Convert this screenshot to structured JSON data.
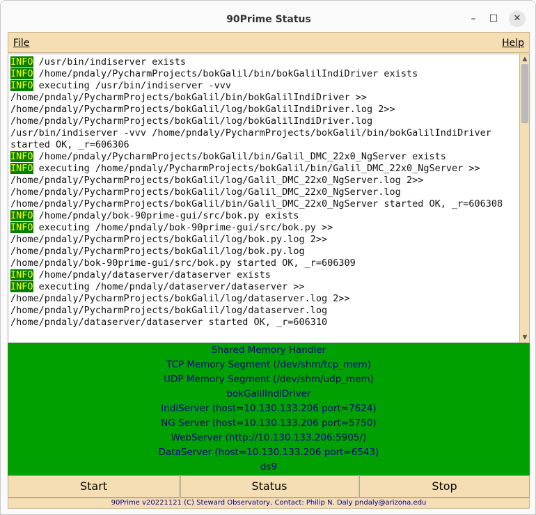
{
  "window": {
    "title": "90Prime Status",
    "controls": {
      "minimize": "–",
      "maximize": "☐",
      "close": "✕"
    }
  },
  "menubar": {
    "file_label": "File",
    "help_label": "Help"
  },
  "log": {
    "lines": [
      {
        "tag": "INFO",
        "text": " /usr/bin/indiserver exists"
      },
      {
        "tag": "INFO",
        "text": " /home/pndaly/PycharmProjects/bokGalil/bin/bokGalilIndiDriver exists"
      },
      {
        "tag": "INFO",
        "text": " executing /usr/bin/indiserver -vvv"
      },
      {
        "tag": "",
        "text": "/home/pndaly/PycharmProjects/bokGalil/bin/bokGalilIndiDriver >>"
      },
      {
        "tag": "",
        "text": "/home/pndaly/PycharmProjects/bokGalil/log/bokGalilIndiDriver.log 2>>"
      },
      {
        "tag": "",
        "text": "/home/pndaly/PycharmProjects/bokGalil/log/bokGalilIndiDriver.log"
      },
      {
        "tag": "",
        "text": "/usr/bin/indiserver -vvv /home/pndaly/PycharmProjects/bokGalil/bin/bokGalilIndiDriver"
      },
      {
        "tag": "",
        "text": "started OK, _r=606306"
      },
      {
        "tag": "INFO",
        "text": " /home/pndaly/PycharmProjects/bokGalil/bin/Galil_DMC_22x0_NgServer exists"
      },
      {
        "tag": "INFO",
        "text": " executing /home/pndaly/PycharmProjects/bokGalil/bin/Galil_DMC_22x0_NgServer >>"
      },
      {
        "tag": "",
        "text": "/home/pndaly/PycharmProjects/bokGalil/log/Galil_DMC_22x0_NgServer.log 2>>"
      },
      {
        "tag": "",
        "text": "/home/pndaly/PycharmProjects/bokGalil/log/Galil_DMC_22x0_NgServer.log"
      },
      {
        "tag": "",
        "text": "/home/pndaly/PycharmProjects/bokGalil/bin/Galil_DMC_22x0_NgServer started OK, _r=606308"
      },
      {
        "tag": "INFO",
        "text": " /home/pndaly/bok-90prime-gui/src/bok.py exists"
      },
      {
        "tag": "INFO",
        "text": " executing /home/pndaly/bok-90prime-gui/src/bok.py >>"
      },
      {
        "tag": "",
        "text": "/home/pndaly/PycharmProjects/bokGalil/log/bok.py.log 2>>"
      },
      {
        "tag": "",
        "text": "/home/pndaly/PycharmProjects/bokGalil/log/bok.py.log"
      },
      {
        "tag": "",
        "text": "/home/pndaly/bok-90prime-gui/src/bok.py started OK, _r=606309"
      },
      {
        "tag": "INFO",
        "text": " /home/pndaly/dataserver/dataserver exists"
      },
      {
        "tag": "INFO",
        "text": " executing /home/pndaly/dataserver/dataserver >>"
      },
      {
        "tag": "",
        "text": "/home/pndaly/PycharmProjects/bokGalil/log/dataserver.log 2>>"
      },
      {
        "tag": "",
        "text": "/home/pndaly/PycharmProjects/bokGalil/log/dataserver.log"
      },
      {
        "tag": "",
        "text": "/home/pndaly/dataserver/dataserver started OK, _r=606310"
      }
    ]
  },
  "status_panel": {
    "background": "#00a000",
    "text_color": "#00008b",
    "lines": [
      "Shared Memory Handler",
      "TCP Memory Segment (/dev/shm/tcp_mem)",
      "UDP Memory Segment (/dev/shm/udp_mem)",
      "bokGalilIndiDriver",
      "IndiServer (host=10.130.133.206 port=7624)",
      "NG Server (host=10.130.133.206 port=5750)",
      "WebServer (http://10.130.133.206:5905/)",
      "DataServer (host=10.130.133.206 port=6543)",
      "ds9"
    ]
  },
  "buttons": {
    "start_label": "Start",
    "status_label": "Status",
    "stop_label": "Stop"
  },
  "footer": {
    "text": "90Prime v20221121 (C) Steward Observatory, Contact: Philip N. Daly pndaly@arizona.edu"
  },
  "colors": {
    "panel": "#f5deb3",
    "info_tag_bg": "#008000",
    "info_tag_fg": "#ffff00"
  }
}
